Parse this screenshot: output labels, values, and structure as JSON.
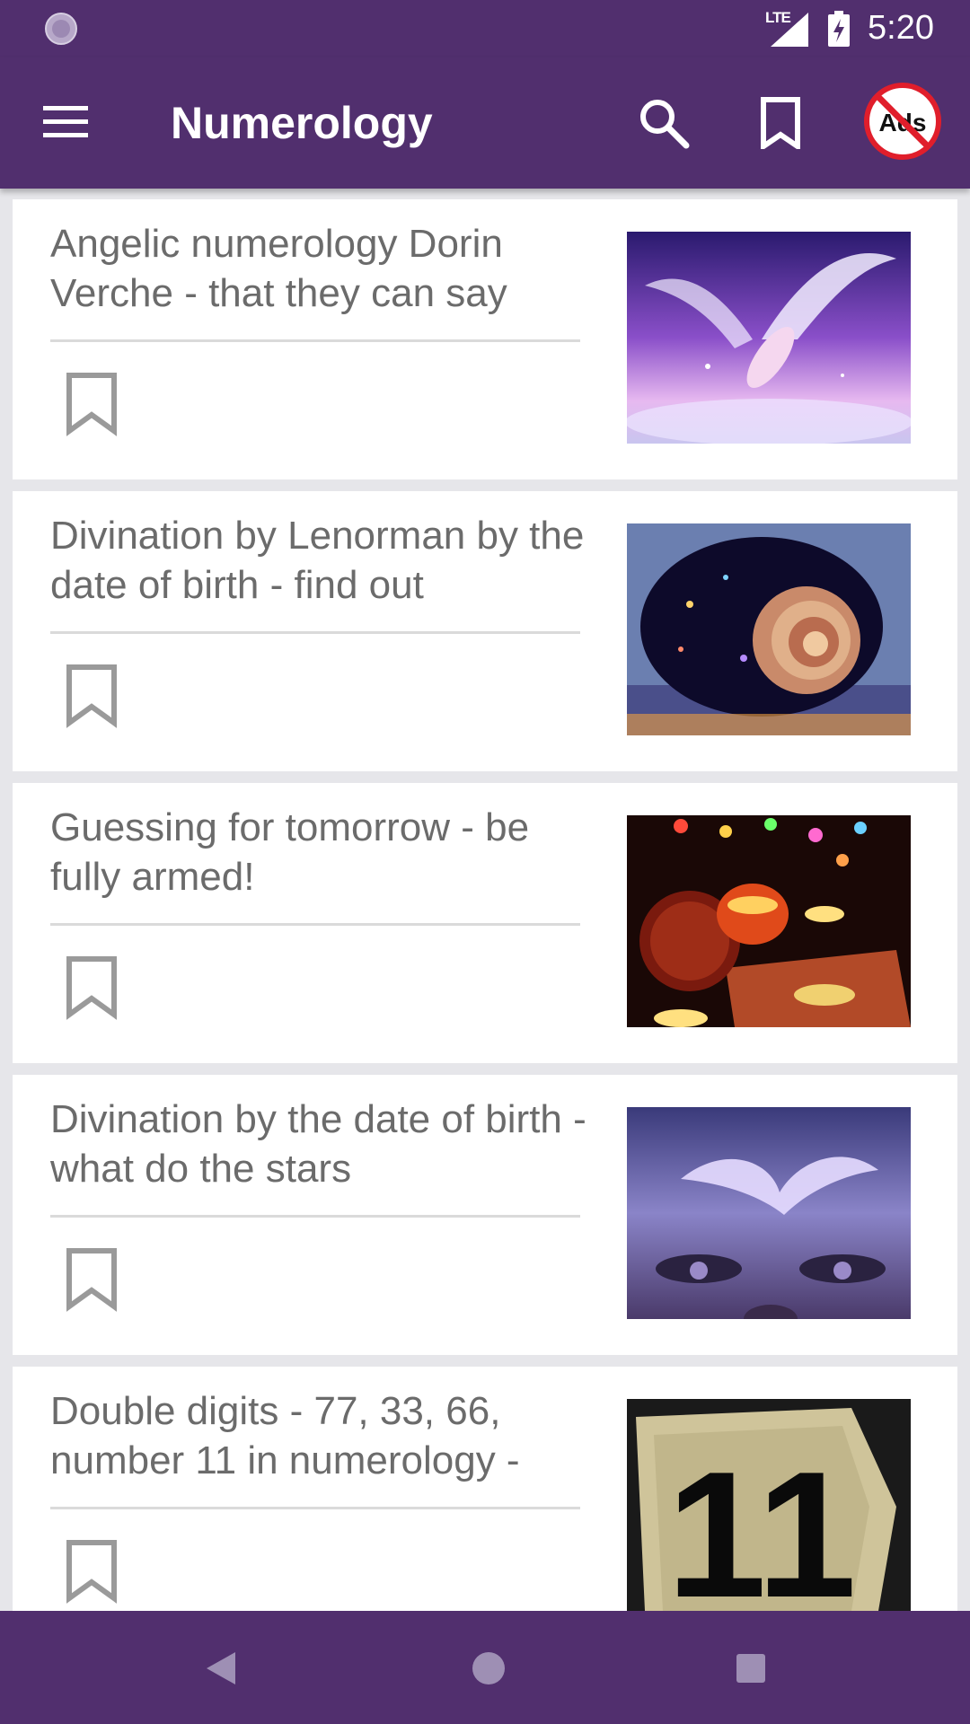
{
  "status_bar": {
    "network": "LTE",
    "time": "5:20"
  },
  "app_bar": {
    "title": "Numerology",
    "menu_icon": "hamburger-menu-icon",
    "search_icon": "search-icon",
    "bookmarks_icon": "bookmark-icon",
    "no_ads_label": "Ads",
    "no_ads_icon": "no-ads-icon"
  },
  "articles": [
    {
      "title": "Angelic numerology Dorin Verche - that they can say",
      "image": "angel-with-wings-image",
      "bookmarked": false
    },
    {
      "title": "Divination by Lenorman by the date of birth - find out",
      "image": "cosmic-nautilus-shell-image",
      "bookmarked": false
    },
    {
      "title": "Guessing for tomorrow - be fully armed!",
      "image": "candles-and-cards-image",
      "bookmarked": false
    },
    {
      "title": "Divination by the date of birth - what do the stars",
      "image": "eyes-and-dove-image",
      "bookmarked": false
    },
    {
      "title": "Double digits - 77, 33, 66, number 11 in numerology -",
      "image": "number-eleven-sign-image",
      "bookmarked": false
    }
  ],
  "nav_bar": {
    "back_icon": "back-triangle-icon",
    "home_icon": "home-circle-icon",
    "recents_icon": "recents-square-icon"
  },
  "colors": {
    "primary": "#512f6e",
    "card_text": "#6b6b6b",
    "background": "#e6e6ea",
    "no_ads_red": "#e01e2b"
  }
}
